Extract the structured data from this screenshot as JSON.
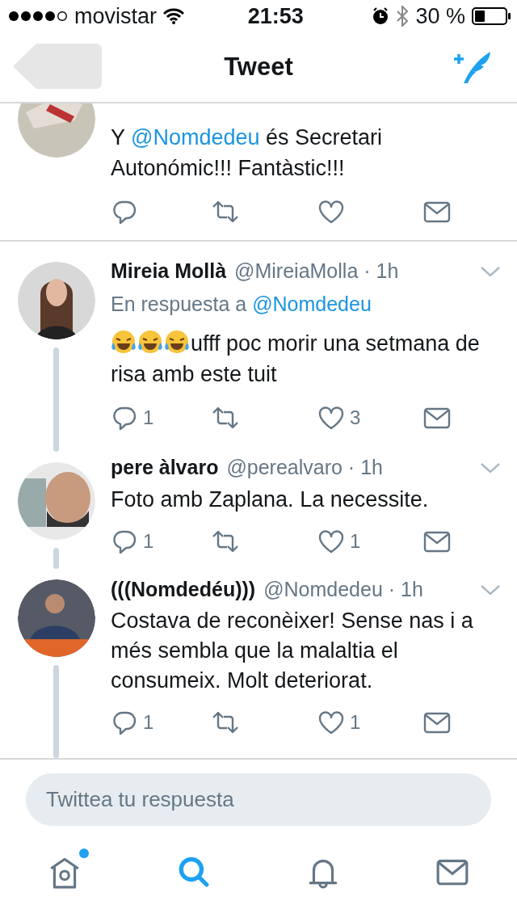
{
  "status_bar": {
    "carrier": "movistar",
    "time": "21:53",
    "battery": "30 %"
  },
  "nav": {
    "title": "Tweet"
  },
  "tweets": [
    {
      "body": [
        {
          "text": "Y "
        },
        {
          "text": "@Nomdedeu",
          "kind": "mention"
        },
        {
          "text": " és Secretari Autonómic!!! Fantàstic!!!"
        }
      ],
      "actions": [
        {
          "kind": "reply"
        },
        {
          "kind": "retweet"
        },
        {
          "kind": "like"
        },
        {
          "kind": "message"
        }
      ]
    },
    {
      "name": "Mireia Mollà",
      "handle": "@MireiaMolla · 1h",
      "reply_to": [
        {
          "text": "En respuesta a "
        },
        {
          "text": "@Nomdedeu",
          "kind": "mention"
        }
      ],
      "emojis": [
        {
          "kind": "tears-of-joy"
        },
        {
          "kind": "tears-of-joy"
        },
        {
          "kind": "tears-of-joy"
        }
      ],
      "body": [
        {
          "text": "ufff poc morir una setmana de risa amb este tuit"
        }
      ],
      "actions": [
        {
          "kind": "reply",
          "count": "1"
        },
        {
          "kind": "retweet"
        },
        {
          "kind": "like",
          "count": "3"
        },
        {
          "kind": "message"
        }
      ]
    },
    {
      "name": "pere àlvaro",
      "handle": "@perealvaro · 1h",
      "body": [
        {
          "text": "Foto amb Zaplana. La necessite."
        }
      ],
      "actions": [
        {
          "kind": "reply",
          "count": "1"
        },
        {
          "kind": "retweet"
        },
        {
          "kind": "like",
          "count": "1"
        },
        {
          "kind": "message"
        }
      ]
    },
    {
      "name": "(((Nomdedéu)))",
      "handle": "@Nomdedeu · 1h",
      "body": [
        {
          "text": "Costava de reconèixer! Sense nas i a més sembla que la malaltia el consumeix. Molt deteriorat."
        }
      ],
      "actions": [
        {
          "kind": "reply",
          "count": "1"
        },
        {
          "kind": "retweet"
        },
        {
          "kind": "like",
          "count": "1"
        },
        {
          "kind": "message"
        }
      ]
    }
  ],
  "reply_field": {
    "placeholder": "Twittea tu respuesta"
  },
  "tab_bar": [
    {
      "kind": "home",
      "selected": false,
      "unread": true
    },
    {
      "kind": "search",
      "selected": true,
      "unread": false
    },
    {
      "kind": "notifications",
      "selected": false,
      "unread": false
    },
    {
      "kind": "messages",
      "selected": false,
      "unread": false
    }
  ]
}
